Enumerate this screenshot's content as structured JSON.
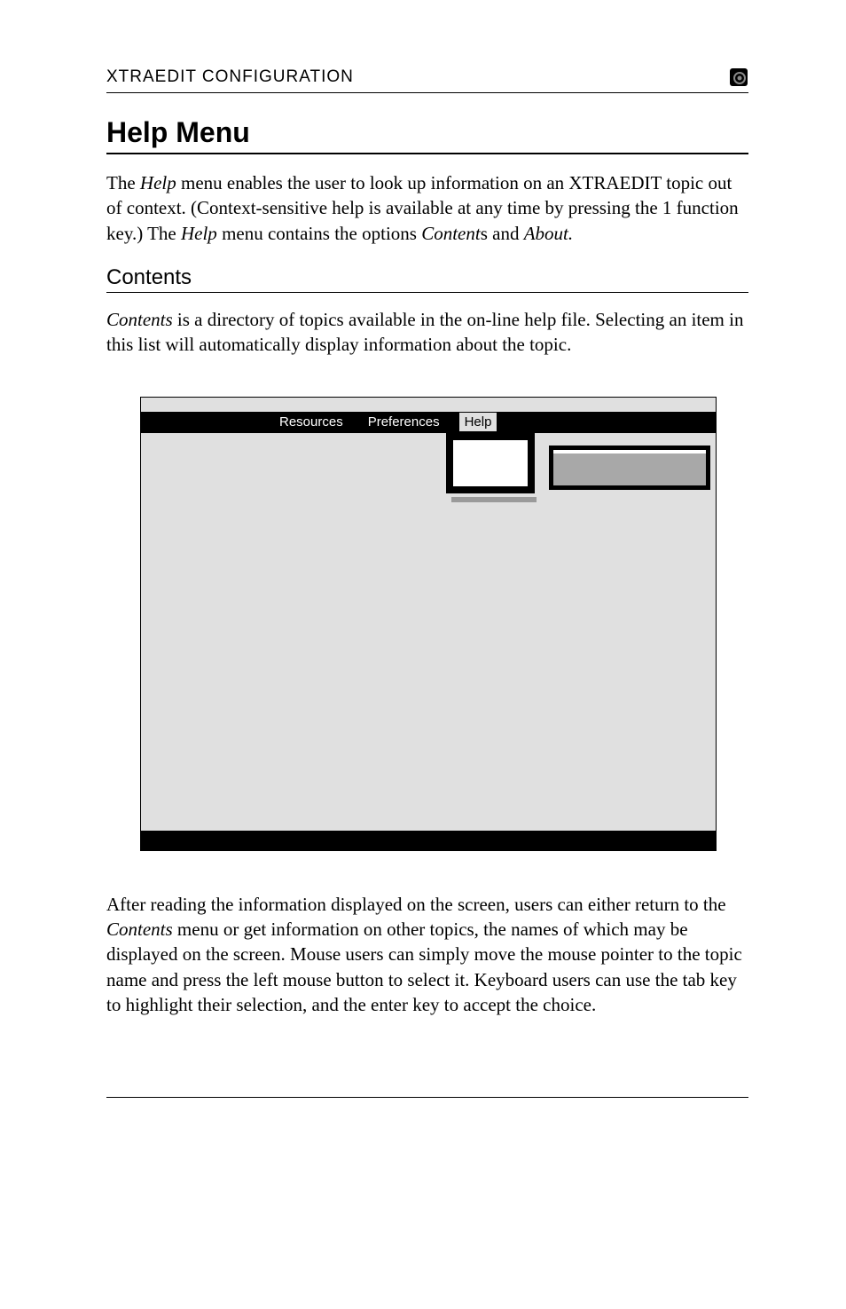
{
  "header": {
    "running_text": "XTRAEDIT CONFIGURATION"
  },
  "section": {
    "heading": "Help Menu",
    "intro_pre": "The ",
    "intro_em1": "Help",
    "intro_mid1": " menu enables the user to look up information on an XTRAEDIT topic out of context. (Context-sensitive help is available at any time by pressing the 1 function key.) The ",
    "intro_em2": "Help",
    "intro_mid2": " menu contains the options ",
    "intro_em3": "Content",
    "intro_plain_s": "s and ",
    "intro_em4": "About.",
    "sub_heading": "Contents",
    "para2_em1": "Contents",
    "para2_rest": " is a directory of topics available in the on-line help file. Selecting an item in this list will automatically display information about the topic.",
    "para3_pre": "After reading the information displayed on the screen, users can either return to the ",
    "para3_em": "Contents",
    "para3_rest": " menu or get information on other topics, the names of which may be displayed on the screen. Mouse users can simply move the mouse pointer to the topic name and press the left mouse button to select it. Keyboard users can use the tab key to highlight their selection, and the enter key to accept the choice."
  },
  "menubar": {
    "resources": "Resources",
    "preferences": "Preferences",
    "help": "Help"
  }
}
